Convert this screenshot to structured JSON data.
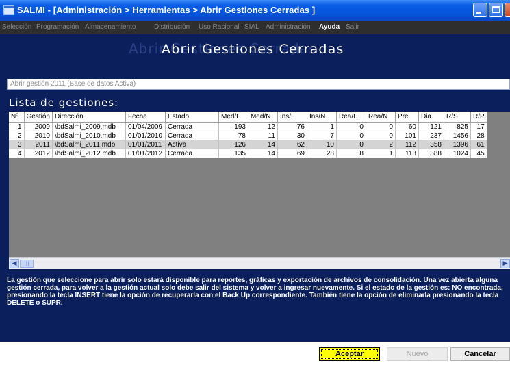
{
  "window": {
    "title": "SALMI - [Administración > Herramientas > Abrir Gestiones Cerradas ]"
  },
  "menu": [
    {
      "label": "Selección",
      "active": false
    },
    {
      "label": "Programación",
      "active": false
    },
    {
      "label": "Almacenamiento",
      "active": false
    },
    {
      "label": "Distribución",
      "active": false
    },
    {
      "label": "Uso Racional",
      "active": false
    },
    {
      "label": "SIAL",
      "active": false
    },
    {
      "label": "Administración",
      "active": false
    },
    {
      "label": "Ayuda",
      "active": true
    },
    {
      "label": "Salir",
      "active": false
    }
  ],
  "page": {
    "title": "Abrir Gestiones Cerradas",
    "status": "Abrir gestión 2011 (Base de datos Activa)",
    "list_title": "Lista de gestiones:"
  },
  "table": {
    "columns": [
      "Nº",
      "Gestión",
      "Dirección",
      "Fecha",
      "Estado",
      "Med/E",
      "Med/N",
      "Ins/E",
      "Ins/N",
      "Rea/E",
      "Rea/N",
      "Pre.",
      "Dia.",
      "R/S",
      "R/P"
    ],
    "rows": [
      {
        "cells": [
          "1",
          "2009",
          "\\bdSalmi_2009.mdb",
          "01/04/2009",
          "Cerrada",
          "193",
          "12",
          "76",
          "1",
          "0",
          "0",
          "60",
          "121",
          "825",
          "17"
        ],
        "selected": false
      },
      {
        "cells": [
          "2",
          "2010",
          "\\bdSalmi_2010.mdb",
          "01/01/2010",
          "Cerrada",
          "78",
          "11",
          "30",
          "7",
          "0",
          "0",
          "101",
          "237",
          "1456",
          "28"
        ],
        "selected": false
      },
      {
        "cells": [
          "3",
          "2011",
          "\\bdSalmi_2011.mdb",
          "01/01/2011",
          "Activa",
          "126",
          "14",
          "62",
          "10",
          "0",
          "2",
          "112",
          "358",
          "1396",
          "61"
        ],
        "selected": true
      },
      {
        "cells": [
          "4",
          "2012",
          "\\bdSalmi_2012.mdb",
          "01/01/2012",
          "Cerrada",
          "135",
          "14",
          "69",
          "28",
          "8",
          "1",
          "113",
          "388",
          "1024",
          "45"
        ],
        "selected": false
      }
    ]
  },
  "info": "La gestión que seleccione para abrir solo estará disponible para reportes, gráficas y exportación de archivos de consolidación. Una vez abierta alguna gestión cerrada, para volver a la gestión actual solo debe salir del sistema y volver a ingresar nuevamente. Si el estado de la gestión es: NO encontrada, presionando la tecla INSERT tiene la opción de recuperarla con el Back Up correspondiente. También tiene la opción de eliminarla presionando la tecla DELETE o SUPR.",
  "buttons": {
    "accept": "Aceptar",
    "new": "Nuevo",
    "cancel": "Cancelar"
  },
  "colors": {
    "panel": "#0a1f5c",
    "titlebar": "#0553d9",
    "accept_button": "#ffff00",
    "menubar": "#2e2e2e"
  }
}
